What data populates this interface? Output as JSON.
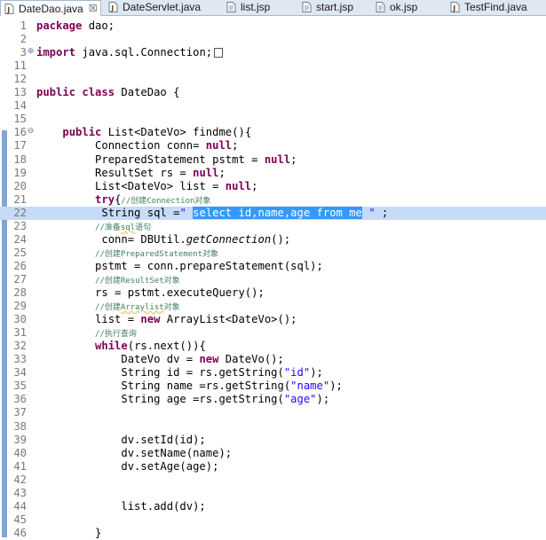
{
  "tabs": [
    {
      "label": "DateDao.java",
      "icon": "java-file-icon",
      "active": true,
      "close": "☒"
    },
    {
      "label": "DateServlet.java",
      "icon": "java-file-icon",
      "active": false
    },
    {
      "label": "list.jsp",
      "icon": "jsp-file-icon",
      "active": false
    },
    {
      "label": "start.jsp",
      "icon": "jsp-file-icon",
      "active": false
    },
    {
      "label": "ok.jsp",
      "icon": "jsp-file-icon",
      "active": false
    },
    {
      "label": "TestFind.java",
      "icon": "java-file-icon",
      "active": false
    }
  ],
  "lines": [
    {
      "n": "1",
      "html": "<span class='kw'>package</span> dao;"
    },
    {
      "n": "2",
      "html": ""
    },
    {
      "n": "3",
      "fold": "⊕",
      "html": "<span class='kw'>import</span> java.sql.Connection;<span class='boxmark'></span>"
    },
    {
      "n": "11",
      "html": ""
    },
    {
      "n": "12",
      "html": ""
    },
    {
      "n": "13",
      "html": "<span class='kw'>public class</span> DateDao {"
    },
    {
      "n": "14",
      "html": ""
    },
    {
      "n": "15",
      "html": ""
    },
    {
      "n": "16",
      "fold": "⊖",
      "html": "    <span class='kw'>public</span> List&lt;DateVo&gt; findme(){"
    },
    {
      "n": "17",
      "html": "         Connection conn= <span class='kw'>null</span>;"
    },
    {
      "n": "18",
      "html": "         PreparedStatement pstmt = <span class='kw'>null</span>;"
    },
    {
      "n": "19",
      "html": "         ResultSet rs = <span class='kw'>null</span>;"
    },
    {
      "n": "20",
      "html": "         List&lt;DateVo&gt; list = <span class='kw'>null</span>;"
    },
    {
      "n": "21",
      "html": "         <span class='kw'>try</span>{<span class='cm'>//创建Connection对象</span>"
    },
    {
      "n": "22",
      "highlight": true,
      "html": "          String sql =<span class='str'>\" <span class='sel'>select id,name,age from me</span> \"</span> ;"
    },
    {
      "n": "23",
      "html": "         <span class='cm'>//准备<span class='squig'>sql</span>语句</span>"
    },
    {
      "n": "24",
      "html": "          conn= DBUtil.<span class='mt'>getConnection</span>();"
    },
    {
      "n": "25",
      "html": "         <span class='cm'>//创建PreparedStatement对象</span>"
    },
    {
      "n": "26",
      "html": "         pstmt = conn.prepareStatement(sql);"
    },
    {
      "n": "27",
      "html": "         <span class='cm'>//创建ResultSet对象</span>"
    },
    {
      "n": "28",
      "html": "         rs = pstmt.executeQuery();"
    },
    {
      "n": "29",
      "html": "         <span class='cm'>//创建<span class='squig'>Arraylist</span>对象</span>"
    },
    {
      "n": "30",
      "html": "         list = <span class='kw'>new</span> ArrayList&lt;DateVo&gt;();"
    },
    {
      "n": "31",
      "html": "         <span class='cm'>//执行查询</span>"
    },
    {
      "n": "32",
      "html": "         <span class='kw'>while</span>(rs.next()){"
    },
    {
      "n": "33",
      "html": "             DateVo dv = <span class='kw'>new</span> DateVo();"
    },
    {
      "n": "34",
      "html": "             String id = rs.getString(<span class='str'>\"id\"</span>);"
    },
    {
      "n": "35",
      "html": "             String name =rs.getString(<span class='str'>\"name\"</span>);"
    },
    {
      "n": "36",
      "html": "             String age =rs.getString(<span class='str'>\"age\"</span>);"
    },
    {
      "n": "37",
      "html": ""
    },
    {
      "n": "38",
      "html": ""
    },
    {
      "n": "39",
      "html": "             dv.setId(id);"
    },
    {
      "n": "40",
      "html": "             dv.setName(name);"
    },
    {
      "n": "41",
      "html": "             dv.setAge(age);"
    },
    {
      "n": "42",
      "html": ""
    },
    {
      "n": "43",
      "html": ""
    },
    {
      "n": "44",
      "html": "             list.add(dv);"
    },
    {
      "n": "45",
      "html": ""
    },
    {
      "n": "46",
      "html": "         }"
    }
  ],
  "colors": {
    "keyword": "#7f0055",
    "string": "#2a00ff",
    "comment": "#3f7f5f",
    "current_line": "#c6dbf7",
    "selection": "#3399ff"
  }
}
